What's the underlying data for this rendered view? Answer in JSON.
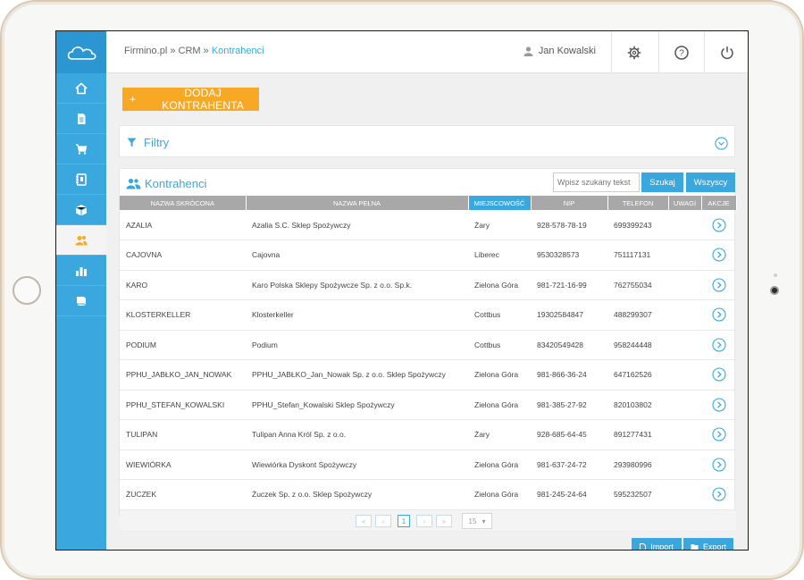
{
  "topbar": {
    "breadcrumb": {
      "part1": "Firmino.pl",
      "sep1": " » ",
      "part2": "CRM",
      "sep2": " » ",
      "current": "Kontrahenci"
    },
    "user_name": "Jan Kowalski"
  },
  "sidebar": {
    "items": [
      {
        "icon": "home-icon"
      },
      {
        "icon": "document-icon"
      },
      {
        "icon": "cart-icon"
      },
      {
        "icon": "address-book-icon"
      },
      {
        "icon": "box-icon"
      },
      {
        "icon": "users-icon",
        "active": true
      },
      {
        "icon": "bar-chart-icon"
      },
      {
        "icon": "book-icon"
      }
    ]
  },
  "actions": {
    "add_label": "DODAJ KONTRAHENTA",
    "add_plus": "+"
  },
  "filter": {
    "title": "Filtry"
  },
  "list": {
    "title": "Kontrahenci",
    "search_placeholder": "Wpisz szukany tekst",
    "search_button": "Szukaj",
    "all_button": "Wszyscy",
    "columns": [
      "NAZWA SKRÓCONA",
      "NAZWA PEŁNA",
      "MIEJSCOWOŚĆ",
      "NIP",
      "TELEFON",
      "UWAGI",
      "AKCJE"
    ],
    "rows": [
      {
        "short": "AZALIA",
        "full": "Azalia S.C. Sklep Spożywczy",
        "city": "Żary",
        "nip": "928-578-78-19",
        "phone": "699399243",
        "notes": ""
      },
      {
        "short": "CAJOVNA",
        "full": "Cajovna",
        "city": "Liberec",
        "nip": "9530328573",
        "phone": "751117131",
        "notes": ""
      },
      {
        "short": "KARO",
        "full": "Karo Polska Sklepy Spożywcze Sp. z o.o. Sp.k.",
        "city": "Zielona Góra",
        "nip": "981-721-16-99",
        "phone": "762755034",
        "notes": ""
      },
      {
        "short": "KLOSTERKELLER",
        "full": "Klosterkeller",
        "city": "Cottbus",
        "nip": "19302584847",
        "phone": "488299307",
        "notes": ""
      },
      {
        "short": "PODIUM",
        "full": "Podium",
        "city": "Cottbus",
        "nip": "83420549428",
        "phone": "958244448",
        "notes": ""
      },
      {
        "short": "PPHU_JABŁKO_JAN_NOWAK",
        "full": "PPHU_JABŁKO_Jan_Nowak Sp. z o.o. Sklep Spożywczy",
        "city": "Zielona Góra",
        "nip": "981-866-36-24",
        "phone": "647162526",
        "notes": ""
      },
      {
        "short": "PPHU_STEFAN_KOWALSKI",
        "full": "PPHU_Stefan_Kowalski Sklep Spożywczy",
        "city": "Zielona Góra",
        "nip": "981-385-27-92",
        "phone": "820103802",
        "notes": ""
      },
      {
        "short": "TULIPAN",
        "full": "Tulipan Anna Król Sp. z o.o.",
        "city": "Żary",
        "nip": "928-685-64-45",
        "phone": "891277431",
        "notes": ""
      },
      {
        "short": "WIEWIÓRKA",
        "full": "Wiewiórka Dyskont Spożywczy",
        "city": "Zielona Góra",
        "nip": "981-637-24-72",
        "phone": "293980996",
        "notes": ""
      },
      {
        "short": "ŻUCZEK",
        "full": "Żuczek Sp. z o.o. Sklep Spożywczy",
        "city": "Zielona Góra",
        "nip": "981-245-24-64",
        "phone": "595232507",
        "notes": ""
      }
    ]
  },
  "pagination": {
    "first": "«",
    "prev": "‹",
    "current_page": "1",
    "next": "›",
    "last": "»",
    "per_page": "15",
    "per_page_arrow": "▾"
  },
  "footer_actions": {
    "import_label": "Import",
    "export_label": "Export"
  },
  "colors": {
    "accent": "#3ba7df",
    "orange": "#f7a825",
    "header_gray": "#a8a8a8"
  }
}
